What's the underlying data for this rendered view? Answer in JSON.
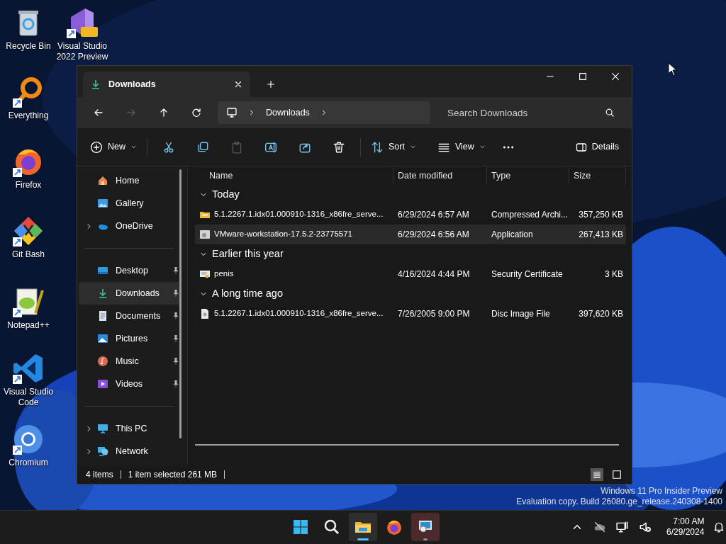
{
  "desktop_icons": [
    {
      "label": "Recycle Bin",
      "kind": "recycle",
      "shortcut": false
    },
    {
      "label": "Visual Studio 2022 Preview",
      "kind": "vs",
      "shortcut": true
    },
    {
      "label": "Everything",
      "kind": "everything",
      "shortcut": true
    },
    {
      "label": "Firefox",
      "kind": "firefox",
      "shortcut": true
    },
    {
      "label": "Git Bash",
      "kind": "git",
      "shortcut": true
    },
    {
      "label": "Notepad++",
      "kind": "notepad",
      "shortcut": true
    },
    {
      "label": "Visual Studio Code",
      "kind": "vscode",
      "shortcut": true
    },
    {
      "label": "Chromium",
      "kind": "chromium",
      "shortcut": true
    }
  ],
  "window": {
    "tabs": [
      {
        "title": "Downloads",
        "selected": true
      }
    ],
    "nav": [
      {
        "kind": "back",
        "disabled": false
      },
      {
        "kind": "forward",
        "disabled": true
      },
      {
        "kind": "up",
        "disabled": false
      },
      {
        "kind": "refresh",
        "disabled": false
      }
    ],
    "address": {
      "segments": [
        "Downloads"
      ]
    },
    "search": {
      "placeholder": "Search Downloads"
    },
    "toolbar": [
      {
        "kind": "new",
        "label": "New",
        "disabled": false
      },
      {
        "kind": "cut",
        "disabled": false
      },
      {
        "kind": "copy",
        "disabled": false
      },
      {
        "kind": "paste",
        "disabled": true
      },
      {
        "kind": "rename",
        "disabled": false
      },
      {
        "kind": "share",
        "disabled": false
      },
      {
        "kind": "delete",
        "disabled": false
      },
      {
        "kind": "sort",
        "label": "Sort",
        "disabled": false
      },
      {
        "kind": "view",
        "label": "View",
        "disabled": false
      },
      {
        "kind": "more",
        "disabled": false
      }
    ],
    "details_button": {
      "label": "Details"
    },
    "sidebar": [
      [
        {
          "label": "Home",
          "kind": "home",
          "expandable": false,
          "pinned": false,
          "selected": false
        },
        {
          "label": "Gallery",
          "kind": "gallery",
          "expandable": false,
          "pinned": false,
          "selected": false
        },
        {
          "label": "OneDrive",
          "kind": "onedrive",
          "expandable": true,
          "pinned": false,
          "selected": false
        }
      ],
      [
        {
          "label": "Desktop",
          "kind": "desktop",
          "expandable": false,
          "pinned": true,
          "selected": false
        },
        {
          "label": "Downloads",
          "kind": "downloads",
          "expandable": false,
          "pinned": true,
          "selected": true
        },
        {
          "label": "Documents",
          "kind": "documents",
          "expandable": false,
          "pinned": true,
          "selected": false
        },
        {
          "label": "Pictures",
          "kind": "pictures",
          "expandable": false,
          "pinned": true,
          "selected": false
        },
        {
          "label": "Music",
          "kind": "music",
          "expandable": false,
          "pinned": true,
          "selected": false
        },
        {
          "label": "Videos",
          "kind": "videos",
          "expandable": false,
          "pinned": true,
          "selected": false
        }
      ],
      [
        {
          "label": "This PC",
          "kind": "pc",
          "expandable": true,
          "pinned": false,
          "selected": false
        },
        {
          "label": "Network",
          "kind": "network",
          "expandable": true,
          "pinned": false,
          "selected": false
        }
      ]
    ],
    "columns": [
      "Name",
      "Date modified",
      "Type",
      "Size"
    ],
    "groups": [
      {
        "title": "Today",
        "expanded": true,
        "files": [
          {
            "name": "5.1.2267.1.idx01.000910-1316_x86fre_serve...",
            "date": "6/29/2024 6:57 AM",
            "type": "Compressed Archi...",
            "size": "357,250 KB",
            "kind": "archive",
            "selected": false
          },
          {
            "name": "VMware-workstation-17.5.2-23775571",
            "date": "6/29/2024 6:56 AM",
            "type": "Application",
            "size": "267,413 KB",
            "kind": "app",
            "selected": true
          }
        ]
      },
      {
        "title": "Earlier this year",
        "expanded": true,
        "files": [
          {
            "name": "penis",
            "date": "4/16/2024 4:44 PM",
            "type": "Security Certificate",
            "size": "3 KB",
            "kind": "cert",
            "selected": false
          }
        ]
      },
      {
        "title": "A long time ago",
        "expanded": true,
        "files": [
          {
            "name": "5.1.2267.1.idx01.000910-1316_x86fre_serve...",
            "date": "7/26/2005 9:00 PM",
            "type": "Disc Image File",
            "size": "397,620 KB",
            "kind": "disc",
            "selected": false
          }
        ]
      }
    ],
    "status_bar": [
      "4 items",
      "1 item selected  261 MB"
    ],
    "view_modes": [
      {
        "kind": "details",
        "selected": true
      },
      {
        "kind": "tiles",
        "selected": false
      }
    ]
  },
  "watermark": [
    "Windows 11 Pro Insider Preview",
    "Evaluation copy. Build 26080.ge_release.240308-1400"
  ],
  "taskbar": {
    "apps": [
      {
        "kind": "start",
        "active": false,
        "attention": false
      },
      {
        "kind": "search",
        "active": false,
        "attention": false
      },
      {
        "kind": "explorer",
        "active": true,
        "attention": false
      },
      {
        "kind": "firefox",
        "active": false,
        "attention": false
      },
      {
        "kind": "vmware",
        "active": false,
        "attention": true
      }
    ],
    "tray": [
      {
        "kind": "chevron"
      },
      {
        "kind": "cloud"
      },
      {
        "kind": "network"
      },
      {
        "kind": "muted"
      }
    ],
    "time": "7:00 AM",
    "date": "6/29/2024"
  }
}
